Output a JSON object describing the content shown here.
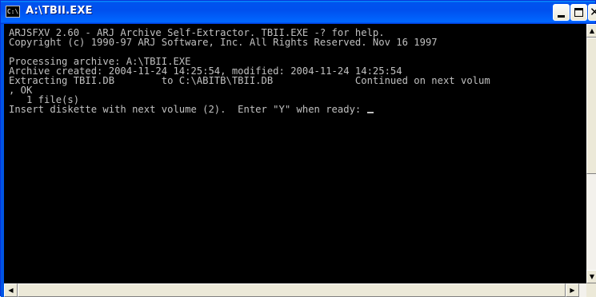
{
  "window": {
    "title": "A:\\TBII.EXE",
    "icon": "cmd-prompt-icon",
    "icon_glyph": "C:\\",
    "controls": {
      "minimize": "minimize-icon",
      "maximize": "maximize-icon",
      "close": "close-icon",
      "close_glyph": "✕"
    }
  },
  "console": {
    "lines": [
      "ARJSFXV 2.60 - ARJ Archive Self-Extractor. TBII.EXE -? for help.",
      "Copyright (c) 1990-97 ARJ Software, Inc. All Rights Reserved. Nov 16 1997",
      "",
      "Processing archive: A:\\TBII.EXE",
      "Archive created: 2004-11-24 14:25:54, modified: 2004-11-24 14:25:54",
      "Extracting TBII.DB        to C:\\ABITB\\TBII.DB              Continued on next volum",
      ", OK",
      "   1 file(s)"
    ],
    "prompt": "Insert diskette with next volume (2).  Enter \"Y\" when ready: ",
    "text_color": "#c0c0c0",
    "background_color": "#000000"
  },
  "scrollbars": {
    "up_arrow": "▲",
    "down_arrow": "▼",
    "left_arrow": "◀",
    "right_arrow": "▶"
  },
  "colors": {
    "titlebar": "#0053ee",
    "chrome": "#ece9d8"
  }
}
